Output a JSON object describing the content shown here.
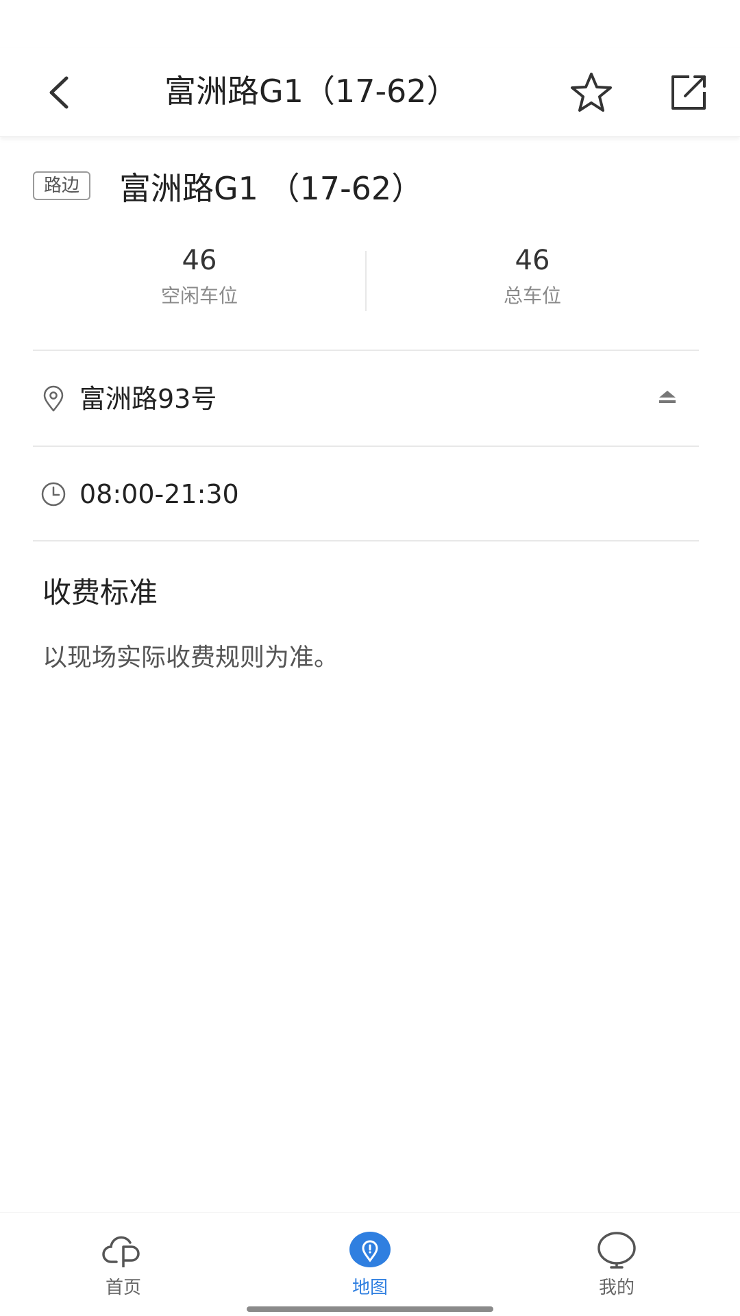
{
  "header": {
    "title": "富洲路G1（17-62）",
    "back_icon": "chevron-left-icon",
    "favorite_icon": "star-outline-icon",
    "share_icon": "share-external-icon"
  },
  "lot": {
    "tag": "路边",
    "name": "富洲路G1 （17-62）"
  },
  "stats": {
    "free": {
      "value": "46",
      "label": "空闲车位"
    },
    "total": {
      "value": "46",
      "label": "总车位"
    }
  },
  "address": {
    "icon": "location-pin-icon",
    "text": "富洲路93号",
    "collapse_icon": "collapse-up-icon"
  },
  "hours": {
    "icon": "clock-icon",
    "text": "08:00-21:30"
  },
  "fee": {
    "title": "收费标准",
    "description": "以现场实际收费规则为准。"
  },
  "tabbar": {
    "items": [
      {
        "label": "首页",
        "icon": "cloud-parking-icon",
        "active": false
      },
      {
        "label": "地图",
        "icon": "map-pin-icon",
        "active": true
      },
      {
        "label": "我的",
        "icon": "profile-bubble-icon",
        "active": false
      }
    ]
  },
  "colors": {
    "accent": "#2f7fe0",
    "text_primary": "#222222",
    "text_secondary": "#8a8a8a",
    "divider": "#e8e8e8"
  }
}
